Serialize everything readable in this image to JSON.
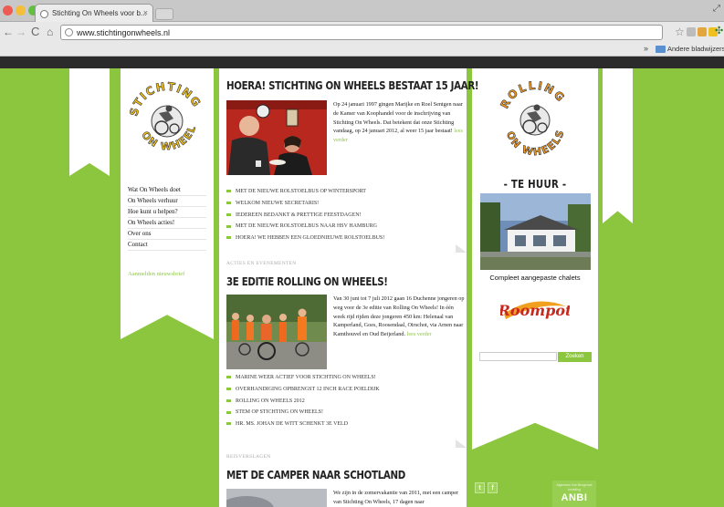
{
  "browser": {
    "tab_title": "Stichting On Wheels voor b...",
    "tab_close": "×",
    "url": "www.stichtingonwheels.nl",
    "bookmarks_chevron": "»",
    "bookmarks_folder": "Andere bladwijzers"
  },
  "left_logo": {
    "text": "STICHTING ON WHEELS"
  },
  "left_nav": {
    "items": [
      "Wat On Wheels doet",
      "On Wheels verhuur",
      "Hoe kunt u helpen?",
      "On Wheels acties!",
      "Over ons",
      "Contact"
    ],
    "anbi_link": "Aanmelden nieuwsbrief"
  },
  "article1": {
    "title": "HOERA! STICHTING ON WHEELS BESTAAT 15 JAAR!",
    "text": "Op 24 januari 1997 gingen Marijke en Roel Sentgen naar de Kamer van Koophandel voor de inschrijving van Stichting On Wheels. Dat betekent dat onze Stichting vandaag, op 24 januari 2012, al weer 15 jaar bestaat!",
    "read_more": "lees verder",
    "links": [
      "Met de nieuwe rolstoelbus op wintersport",
      "Welkom nieuwe secretaris!",
      "Iedereen bedankt & prettige feestdagen!",
      "Met de nieuwe rolstoelbus naar HSV Hamburg",
      "Hoera! We hebben een gloednieuwe rolstoelbus!"
    ]
  },
  "article2": {
    "category": "Acties en evenementen",
    "title": "3E EDITIE ROLLING ON WHEELS!",
    "text": "Van 30 juni tot 7 juli 2012 gaan 16 Duchenne jongeren op weg voor de 3e editie van Rolling On Wheels! In één week rijd rijden deze jongeren 450 km: Helenaal van Kamperland, Goes, Roosendaal, Oirschot, via Arnen naar Kamthouvel en Oud Beijerland.",
    "read_more": "lees verder",
    "links": [
      "Marine weer actief voor Stichting On Wheels!",
      "Overhandiging opbrengst 12 inch race poeldijk",
      "Rolling On Wheels 2012",
      "Stem op Stichting On Wheels!",
      "Hr. Ms. Johan de Witt schenkt 3e veld"
    ]
  },
  "article3": {
    "category": "Reisverslagen",
    "title": "MET DE CAMPER NAAR SCHOTLAND",
    "text": "We zijn in de zomervakantie van 2011, met een camper van Stichting On Wheels, 17 dagen naar"
  },
  "right_logo": {
    "text": "ROLLING ON WHEELS"
  },
  "sidebar": {
    "heading": "- TE HUUR -",
    "caption": "Compleet aangepaste chalets",
    "roompot": "Roompot",
    "search_button": "Zoeken",
    "search_placeholder": ""
  },
  "social": {
    "twitter": "t",
    "facebook": "f"
  },
  "anbi": {
    "small": "Algemeen Nut Beogende Instelling",
    "label": "ANBI"
  },
  "colors": {
    "brand_green": "#8cc63f",
    "dark_bar": "#2b2b2b",
    "roompot_red": "#c8281e"
  }
}
